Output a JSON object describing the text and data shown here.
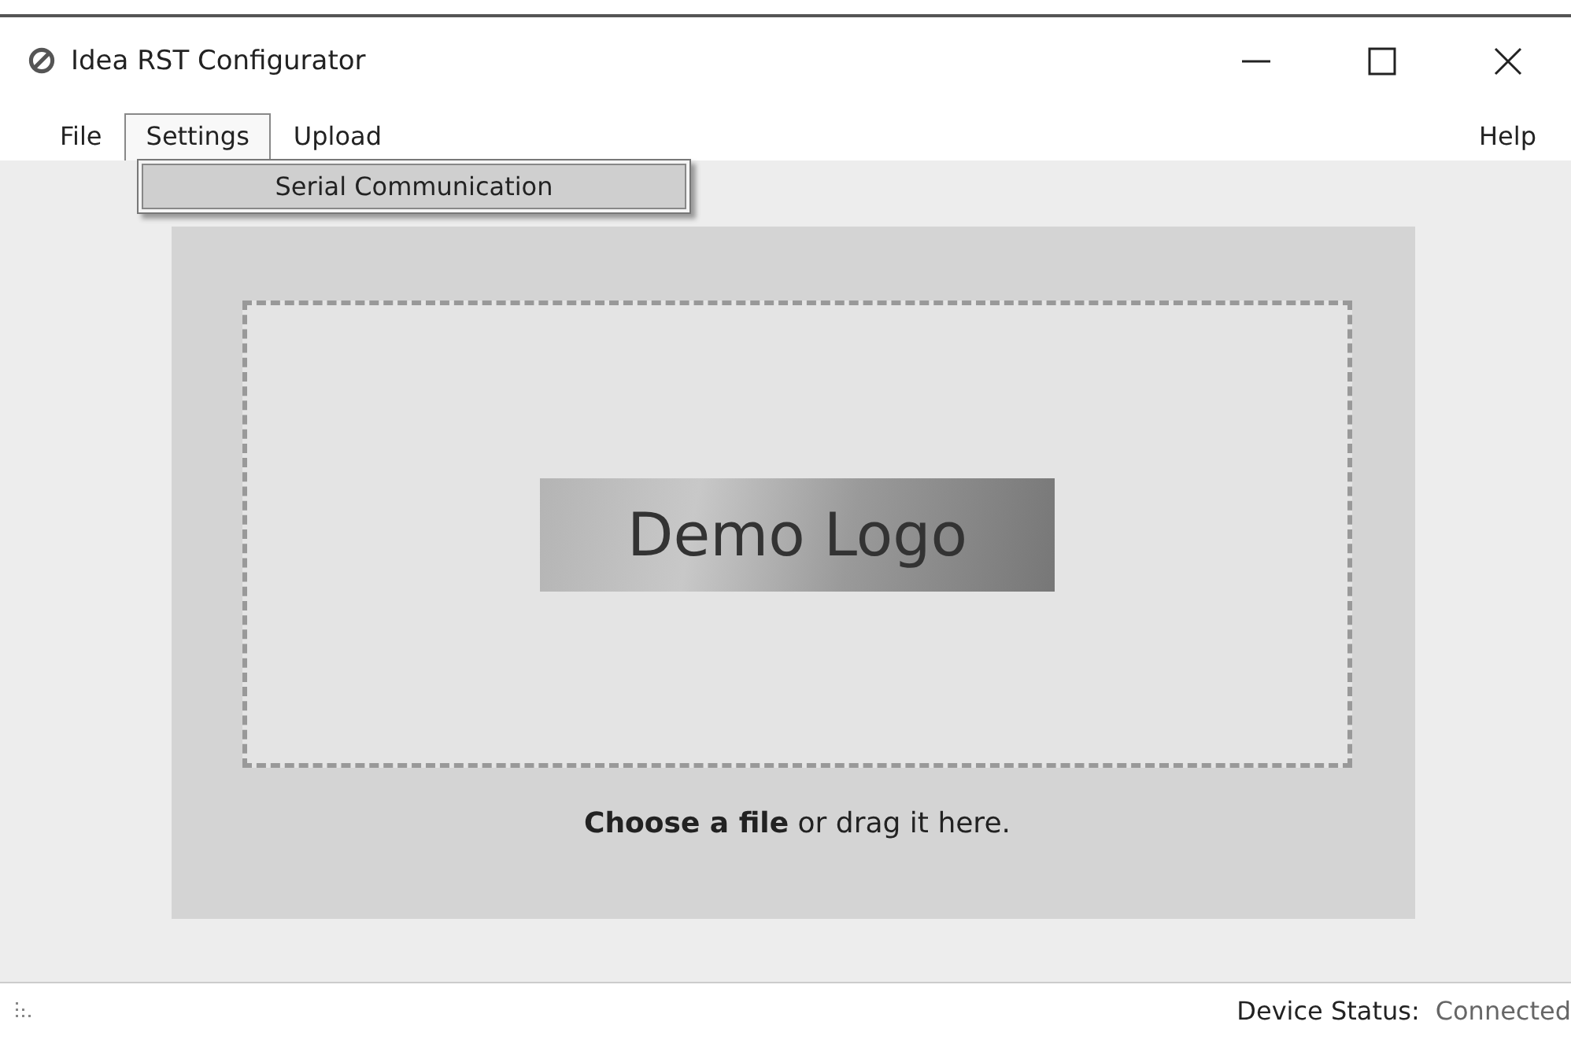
{
  "window": {
    "title": "Idea RST Configurator"
  },
  "menu": {
    "items": [
      {
        "label": "File",
        "selected": false
      },
      {
        "label": "Settings",
        "selected": true
      },
      {
        "label": "Upload",
        "selected": false
      }
    ],
    "help": "Help",
    "dropdown": {
      "items": [
        {
          "label": "Serial Communication",
          "selected": true
        }
      ]
    }
  },
  "drop_zone": {
    "logo": "Demo Logo",
    "caption": "**Choose a file** or drag it here."
  },
  "status_bar": {
    "label": "Device Status:",
    "value": "Connected"
  }
}
